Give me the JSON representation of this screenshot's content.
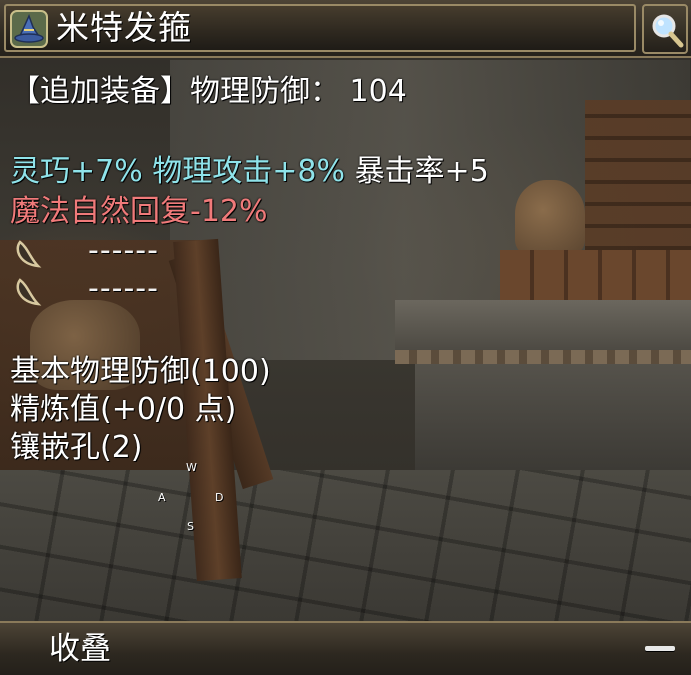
{
  "item": {
    "name": "米特发箍",
    "icon": "wizard-hat-icon"
  },
  "header": {
    "search_icon": "magnifier-icon"
  },
  "stats": {
    "attach_line": "【追加装备】物理防御： 104",
    "bonus": [
      {
        "text": "灵巧+7%",
        "color": "#8fe3ea"
      },
      {
        "text": "物理攻击+8%",
        "color": "#8fe3ea"
      },
      {
        "text": "暴击率+5",
        "color": "#ffffff"
      }
    ],
    "penalty": "魔法自然回复-12%",
    "penalty_color": "#f07a7a",
    "sockets": [
      {
        "icon": "empty-socket-icon",
        "label": "------"
      },
      {
        "icon": "empty-socket-icon",
        "label": "------"
      }
    ],
    "base_defense": "基本物理防御(100)",
    "refine": "精炼值(+0/0 点)",
    "holes": "镶嵌孔(2)"
  },
  "wasd": {
    "w": "W",
    "a": "A",
    "d": "D",
    "s": "S"
  },
  "footer": {
    "collapse_label": "收叠",
    "minus_icon": "minus-icon"
  }
}
